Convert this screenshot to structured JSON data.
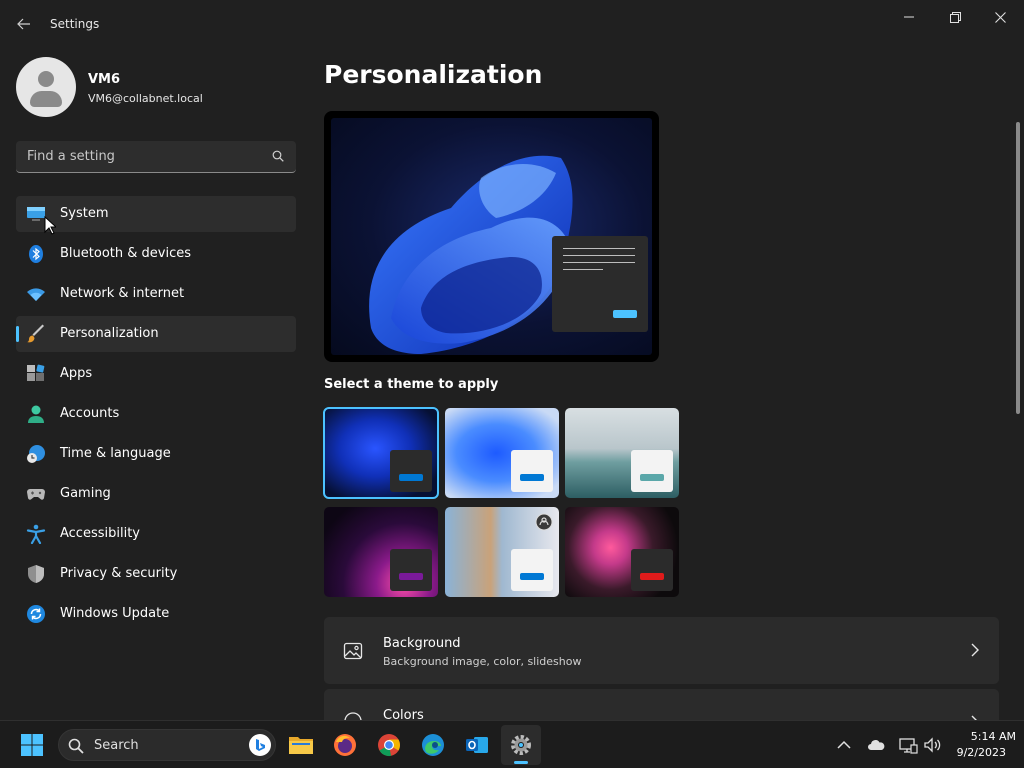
{
  "window": {
    "app_title": "Settings",
    "back_icon": "back-arrow-icon",
    "controls": [
      "minimize-icon",
      "restore-icon",
      "close-icon"
    ]
  },
  "profile": {
    "name": "VM6",
    "email": "VM6@collabnet.local"
  },
  "search": {
    "placeholder": "Find a setting",
    "value": ""
  },
  "sidebar": {
    "items": [
      {
        "label": "System",
        "icon": "system-icon"
      },
      {
        "label": "Bluetooth & devices",
        "icon": "bluetooth-icon"
      },
      {
        "label": "Network & internet",
        "icon": "wifi-icon"
      },
      {
        "label": "Personalization",
        "icon": "brush-icon",
        "active": true
      },
      {
        "label": "Apps",
        "icon": "apps-icon"
      },
      {
        "label": "Accounts",
        "icon": "accounts-icon"
      },
      {
        "label": "Time & language",
        "icon": "globe-clock-icon"
      },
      {
        "label": "Gaming",
        "icon": "gamepad-icon"
      },
      {
        "label": "Accessibility",
        "icon": "accessibility-icon"
      },
      {
        "label": "Privacy & security",
        "icon": "shield-icon"
      },
      {
        "label": "Windows Update",
        "icon": "update-icon"
      }
    ]
  },
  "main": {
    "title": "Personalization",
    "themes_label": "Select a theme to apply",
    "cards": [
      {
        "title": "Background",
        "subtitle": "Background image, color, slideshow",
        "icon": "image-icon"
      },
      {
        "title": "Colors",
        "subtitle": "",
        "icon": "palette-icon"
      }
    ]
  },
  "colors": {
    "accent": "#4cc2ff",
    "background": "#202020",
    "card": "#2b2b2b"
  },
  "taskbar": {
    "search_label": "Search",
    "time": "5:14 AM",
    "date": "9/2/2023"
  }
}
